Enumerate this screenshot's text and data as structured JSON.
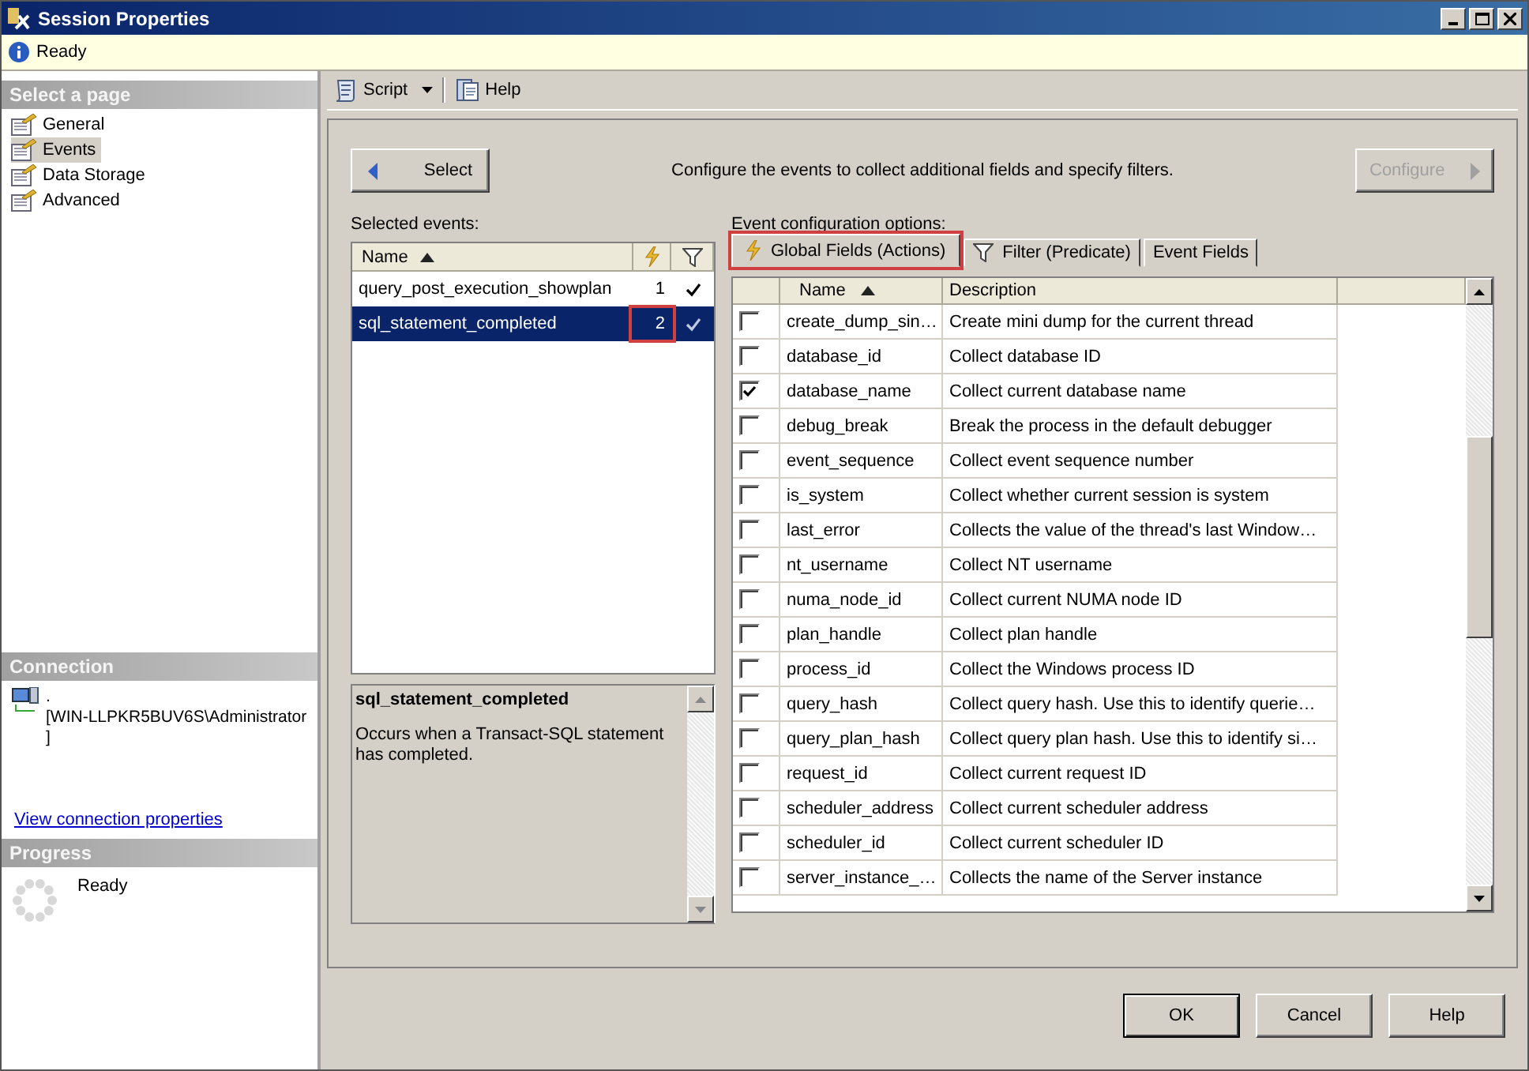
{
  "window": {
    "title": "Session Properties"
  },
  "status": {
    "text": "Ready"
  },
  "sidebar": {
    "header": "Select a page",
    "items": [
      {
        "label": "General",
        "selected": false
      },
      {
        "label": "Events",
        "selected": true
      },
      {
        "label": "Data Storage",
        "selected": false
      },
      {
        "label": "Advanced",
        "selected": false
      }
    ]
  },
  "connection": {
    "header": "Connection",
    "server": ".",
    "user": "[WIN-LLPKR5BUV6S\\Administrator\n]",
    "link": "View connection properties"
  },
  "progress": {
    "header": "Progress",
    "status": "Ready"
  },
  "toolbar": [
    {
      "label": "Script",
      "kind": "script"
    },
    {
      "label": "Help",
      "kind": "help"
    }
  ],
  "select_button": "Select",
  "instruction": "Configure the events to collect additional fields and specify filters.",
  "configure_button": {
    "label": "Configure",
    "disabled": true
  },
  "events": {
    "label": "Selected events:",
    "column": "Name",
    "rows": [
      {
        "name": "query_post_execution_showplan",
        "count": "1",
        "filtered": true,
        "selected": false,
        "highlighted": false
      },
      {
        "name": "sql_statement_completed",
        "count": "2",
        "filtered": true,
        "selected": true,
        "highlighted": true
      }
    ]
  },
  "description": {
    "title": "sql_statement_completed",
    "text": "Occurs when a Transact-SQL statement has completed."
  },
  "config": {
    "label": "Event configuration options:",
    "tabs": [
      {
        "label": "Global Fields (Actions)",
        "kind": "actions",
        "selected": true,
        "highlighted": true
      },
      {
        "label": "Filter (Predicate)",
        "kind": "filter",
        "selected": false,
        "highlighted": false
      },
      {
        "label": "Event Fields",
        "kind": "fields",
        "selected": false,
        "highlighted": false
      }
    ],
    "columns": [
      "Name",
      "Description"
    ],
    "rows": [
      {
        "name": "create_dump_sin…",
        "description": "Create mini dump for the current thread",
        "checked": false
      },
      {
        "name": "database_id",
        "description": "Collect database ID",
        "checked": false
      },
      {
        "name": "database_name",
        "description": "Collect current database name",
        "checked": true
      },
      {
        "name": "debug_break",
        "description": "Break the process in the default debugger",
        "checked": false
      },
      {
        "name": "event_sequence",
        "description": "Collect event sequence number",
        "checked": false
      },
      {
        "name": "is_system",
        "description": "Collect whether current session is system",
        "checked": false
      },
      {
        "name": "last_error",
        "description": "Collects the value of the thread's last Window…",
        "checked": false
      },
      {
        "name": "nt_username",
        "description": "Collect NT username",
        "checked": false
      },
      {
        "name": "numa_node_id",
        "description": "Collect current NUMA node ID",
        "checked": false
      },
      {
        "name": "plan_handle",
        "description": "Collect plan handle",
        "checked": false
      },
      {
        "name": "process_id",
        "description": "Collect the Windows process ID",
        "checked": false
      },
      {
        "name": "query_hash",
        "description": "Collect query hash. Use this to identify querie…",
        "checked": false
      },
      {
        "name": "query_plan_hash",
        "description": "Collect query plan hash. Use this to identify si…",
        "checked": false
      },
      {
        "name": "request_id",
        "description": "Collect current request ID",
        "checked": false
      },
      {
        "name": "scheduler_address",
        "description": "Collect current scheduler address",
        "checked": false
      },
      {
        "name": "scheduler_id",
        "description": "Collect current scheduler ID",
        "checked": false
      },
      {
        "name": "server_instance_…",
        "description": "Collects the name of the Server instance",
        "checked": false
      }
    ]
  },
  "buttons": [
    "OK",
    "Cancel",
    "Help"
  ]
}
